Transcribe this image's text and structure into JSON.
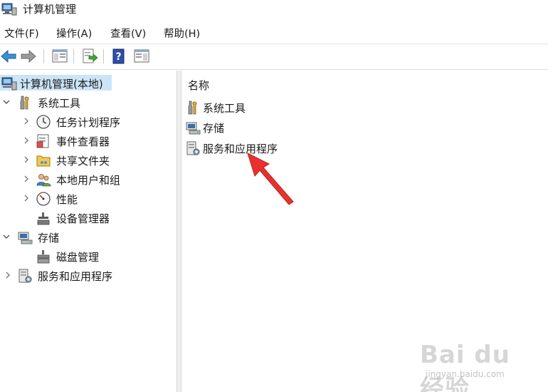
{
  "window": {
    "title": "计算机管理"
  },
  "menu": [
    "文件(F)",
    "操作(A)",
    "查看(V)",
    "帮助(H)"
  ],
  "toolbar": {
    "buttons": [
      "back-icon",
      "forward-icon",
      "show-hide-console-tree-icon",
      "export-list-icon",
      "help-icon",
      "show-hide-action-pane-icon"
    ]
  },
  "tree": {
    "root": "计算机管理(本地)",
    "system_tools": "系统工具",
    "task_scheduler": "任务计划程序",
    "event_viewer": "事件查看器",
    "shared_folders": "共享文件夹",
    "local_users_groups": "本地用户和组",
    "performance": "性能",
    "device_manager": "设备管理器",
    "storage": "存储",
    "disk_management": "磁盘管理",
    "services_apps": "服务和应用程序"
  },
  "list": {
    "column_header": "名称",
    "items": [
      "系统工具",
      "存储",
      "服务和应用程序"
    ]
  },
  "watermark": {
    "brand": "Bai du 经验",
    "url": "jingyan.baidu.com"
  },
  "colors": {
    "selection": "#cce4f7",
    "annotation_arrow": "#e8312f"
  }
}
